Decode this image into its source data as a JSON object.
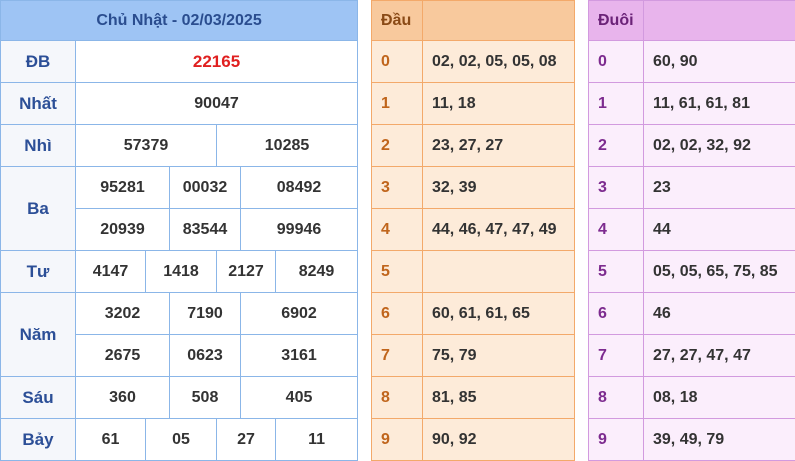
{
  "results": {
    "title": "Chủ Nhật - 02/03/2025",
    "rows": [
      {
        "label": "ĐB",
        "values": [
          "22165"
        ]
      },
      {
        "label": "Nhất",
        "values": [
          "90047"
        ]
      },
      {
        "label": "Nhì",
        "values": [
          "57379",
          "10285"
        ]
      },
      {
        "label": "Ba",
        "values": [
          "95281",
          "00032",
          "08492",
          "20939",
          "83544",
          "99946"
        ]
      },
      {
        "label": "Tư",
        "values": [
          "4147",
          "1418",
          "2127",
          "8249"
        ]
      },
      {
        "label": "Năm",
        "values": [
          "3202",
          "7190",
          "6902",
          "2675",
          "0623",
          "3161"
        ]
      },
      {
        "label": "Sáu",
        "values": [
          "360",
          "508",
          "405"
        ]
      },
      {
        "label": "Bảy",
        "values": [
          "61",
          "05",
          "27",
          "11"
        ]
      }
    ]
  },
  "dau": {
    "title": "Đầu",
    "rows": [
      {
        "digit": "0",
        "values": "02, 02, 05, 05, 08"
      },
      {
        "digit": "1",
        "values": "11, 18"
      },
      {
        "digit": "2",
        "values": "23, 27, 27"
      },
      {
        "digit": "3",
        "values": "32, 39"
      },
      {
        "digit": "4",
        "values": "44, 46, 47, 47, 49"
      },
      {
        "digit": "5",
        "values": ""
      },
      {
        "digit": "6",
        "values": "60, 61, 61, 65"
      },
      {
        "digit": "7",
        "values": "75, 79"
      },
      {
        "digit": "8",
        "values": "81, 85"
      },
      {
        "digit": "9",
        "values": "90, 92"
      }
    ]
  },
  "duoi": {
    "title": "Đuôi",
    "rows": [
      {
        "digit": "0",
        "values": "60, 90"
      },
      {
        "digit": "1",
        "values": "11, 61, 61, 81"
      },
      {
        "digit": "2",
        "values": "02, 02, 32, 92"
      },
      {
        "digit": "3",
        "values": "23"
      },
      {
        "digit": "4",
        "values": "44"
      },
      {
        "digit": "5",
        "values": "05, 05, 65, 75, 85"
      },
      {
        "digit": "6",
        "values": "46"
      },
      {
        "digit": "7",
        "values": "27, 27, 47, 47"
      },
      {
        "digit": "8",
        "values": "08, 18"
      },
      {
        "digit": "9",
        "values": "39, 49, 79"
      }
    ]
  },
  "colors": {
    "special_prize": "#e02020",
    "results_header": "#9ec4f4",
    "dau_header": "#f8c99d",
    "duoi_header": "#e8b4ec"
  }
}
